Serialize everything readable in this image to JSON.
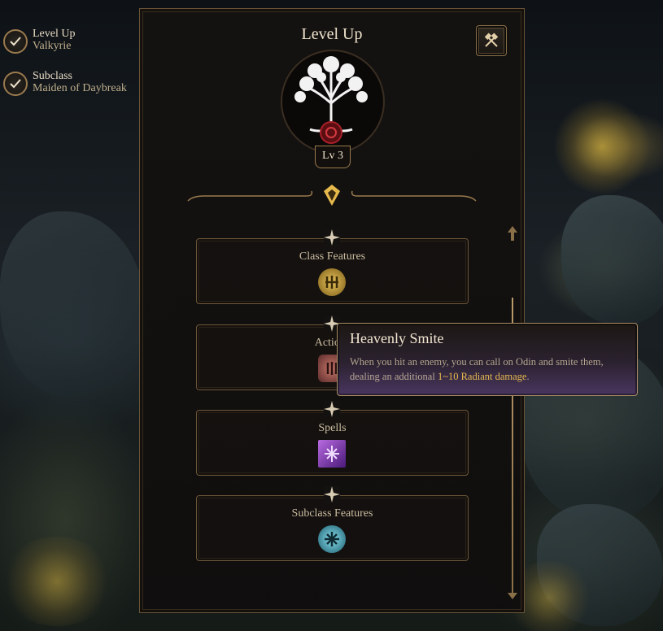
{
  "progress": {
    "items": [
      {
        "title": "Level Up",
        "subtitle": "Valkyrie"
      },
      {
        "title": "Subclass",
        "subtitle": "Maiden of Daybreak"
      }
    ]
  },
  "panel": {
    "title": "Level Up",
    "level_badge": "Lv 3"
  },
  "sections": [
    {
      "label": "Class Features",
      "icon": "class-features-icon"
    },
    {
      "label": "Actions",
      "icon": "actions-icon"
    },
    {
      "label": "Spells",
      "icon": "spells-icon"
    },
    {
      "label": "Subclass Features",
      "icon": "subclass-features-icon"
    }
  ],
  "tooltip": {
    "title": "Heavenly Smite",
    "body_prefix": "When you hit an enemy, you can call on Odin and smite them, dealing an additional ",
    "body_highlight": "1~10 Radiant damage",
    "body_suffix": "."
  },
  "colors": {
    "accent_gold": "#e6b94d",
    "frame_bronze": "#9a7a4e",
    "tooltip_purple": "#4a3660"
  }
}
